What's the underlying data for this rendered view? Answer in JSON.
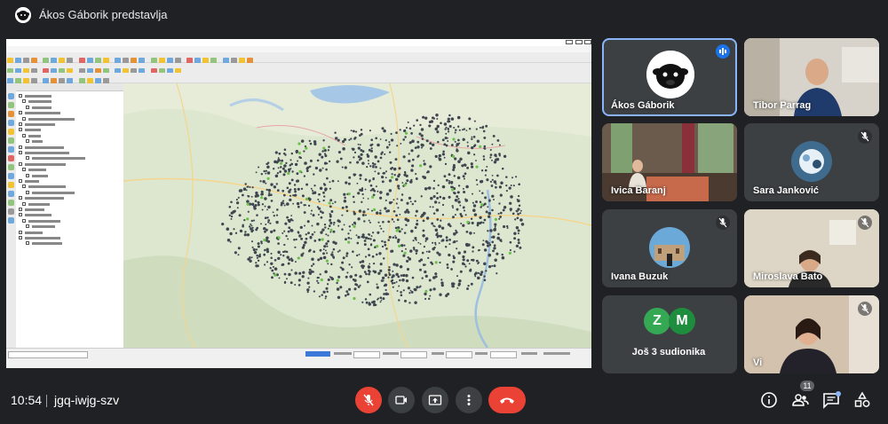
{
  "header": {
    "presenting_title": "Ákos Gáborik predstavlja"
  },
  "participants": [
    {
      "name": "Ákos Gáborik"
    },
    {
      "name": "Tibor Parrag"
    },
    {
      "name": "Ivica Baranj"
    },
    {
      "name": "Sara Janković"
    },
    {
      "name": "Ivana Buzuk"
    },
    {
      "name": "Miroslava Bato"
    },
    {
      "name": "Vi"
    }
  ],
  "more_tile": {
    "label": "Još 3 sudionika",
    "avatars": [
      "Z",
      "M"
    ]
  },
  "footer": {
    "time": "10:54",
    "meeting_code": "jgq-iwjg-szv",
    "participant_count": "11"
  },
  "colors": {
    "background": "#202124",
    "tile": "#3c4043",
    "accent": "#8ab4f8",
    "danger": "#ea4335",
    "speaking": "#1a73e8",
    "avatar_z": "#34a853",
    "avatar_m": "#1e8e3e"
  },
  "icons": [
    "present-to-all-icon",
    "mic-off-icon",
    "camera-icon",
    "present-icon",
    "more-options-icon",
    "hang-up-icon",
    "info-icon",
    "people-icon",
    "chat-icon",
    "activities-icon"
  ]
}
